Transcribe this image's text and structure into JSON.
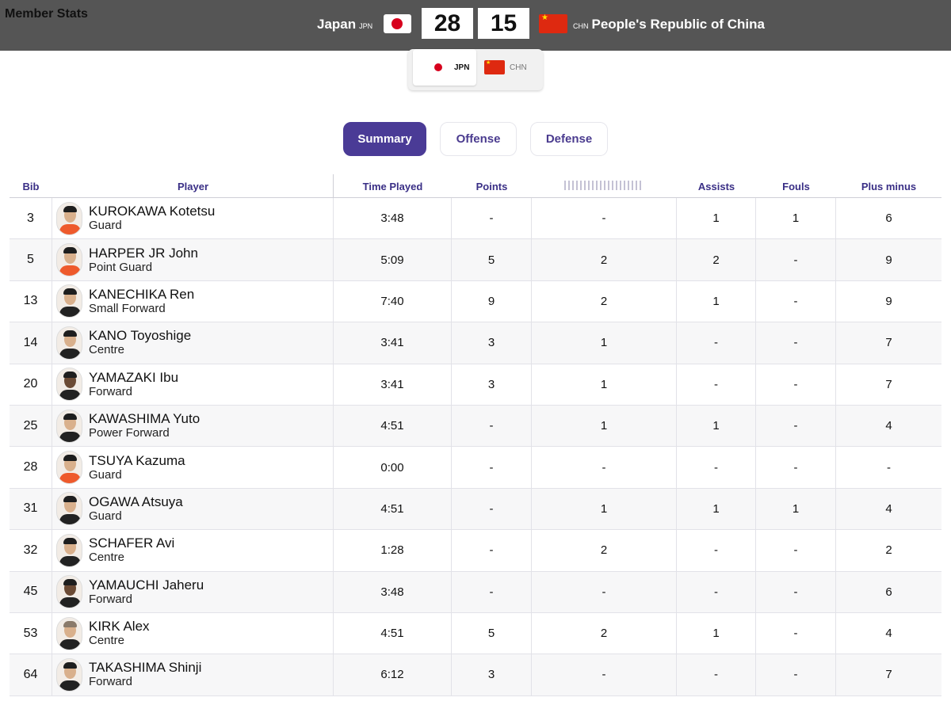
{
  "page": {
    "title": "Member Stats"
  },
  "match": {
    "home": {
      "name": "Japan",
      "code": "JPN",
      "score": "28"
    },
    "away": {
      "name": "People's Republic of China",
      "code": "CHN",
      "score": "15"
    }
  },
  "team_toggle": {
    "home_label": "JPN",
    "away_label": "CHN",
    "selected": "JPN"
  },
  "tabs": [
    {
      "label": "Summary",
      "active": true
    },
    {
      "label": "Offense",
      "active": false
    },
    {
      "label": "Defense",
      "active": false
    }
  ],
  "table": {
    "headers": {
      "bib": "Bib",
      "player": "Player",
      "time_played": "Time Played",
      "points": "Points",
      "assists": "Assists",
      "fouls": "Fouls",
      "plus_minus": "Plus minus"
    },
    "rows": [
      {
        "bib": "3",
        "name": "KUROKAWA Kotetsu",
        "position": "Guard",
        "time": "3:48",
        "points": "-",
        "col5": "-",
        "assists": "1",
        "fouls": "1",
        "plus_minus": "6"
      },
      {
        "bib": "5",
        "name": "HARPER JR John",
        "position": "Point Guard",
        "time": "5:09",
        "points": "5",
        "col5": "2",
        "assists": "2",
        "fouls": "-",
        "plus_minus": "9"
      },
      {
        "bib": "13",
        "name": "KANECHIKA Ren",
        "position": "Small Forward",
        "time": "7:40",
        "points": "9",
        "col5": "2",
        "assists": "1",
        "fouls": "-",
        "plus_minus": "9"
      },
      {
        "bib": "14",
        "name": "KANO Toyoshige",
        "position": "Centre",
        "time": "3:41",
        "points": "3",
        "col5": "1",
        "assists": "-",
        "fouls": "-",
        "plus_minus": "7"
      },
      {
        "bib": "20",
        "name": "YAMAZAKI Ibu",
        "position": "Forward",
        "time": "3:41",
        "points": "3",
        "col5": "1",
        "assists": "-",
        "fouls": "-",
        "plus_minus": "7"
      },
      {
        "bib": "25",
        "name": "KAWASHIMA Yuto",
        "position": "Power Forward",
        "time": "4:51",
        "points": "-",
        "col5": "1",
        "assists": "1",
        "fouls": "-",
        "plus_minus": "4"
      },
      {
        "bib": "28",
        "name": "TSUYA Kazuma",
        "position": "Guard",
        "time": "0:00",
        "points": "-",
        "col5": "-",
        "assists": "-",
        "fouls": "-",
        "plus_minus": "-"
      },
      {
        "bib": "31",
        "name": "OGAWA Atsuya",
        "position": "Guard",
        "time": "4:51",
        "points": "-",
        "col5": "1",
        "assists": "1",
        "fouls": "1",
        "plus_minus": "4"
      },
      {
        "bib": "32",
        "name": "SCHAFER Avi",
        "position": "Centre",
        "time": "1:28",
        "points": "-",
        "col5": "2",
        "assists": "-",
        "fouls": "-",
        "plus_minus": "2"
      },
      {
        "bib": "45",
        "name": "YAMAUCHI Jaheru",
        "position": "Forward",
        "time": "3:48",
        "points": "-",
        "col5": "-",
        "assists": "-",
        "fouls": "-",
        "plus_minus": "6"
      },
      {
        "bib": "53",
        "name": "KIRK Alex",
        "position": "Centre",
        "time": "4:51",
        "points": "5",
        "col5": "2",
        "assists": "1",
        "fouls": "-",
        "plus_minus": "4"
      },
      {
        "bib": "64",
        "name": "TAKASHIMA Shinji",
        "position": "Forward",
        "time": "6:12",
        "points": "3",
        "col5": "-",
        "assists": "-",
        "fouls": "-",
        "plus_minus": "7"
      }
    ]
  },
  "colors": {
    "accent": "#4a3b96",
    "header_bar": "#555555",
    "header_text": "#3a2f86",
    "japan_red": "#d7001d",
    "china_red": "#de2910"
  },
  "icons": [
    "japan-flag-icon",
    "china-flag-icon",
    "player-avatar"
  ]
}
